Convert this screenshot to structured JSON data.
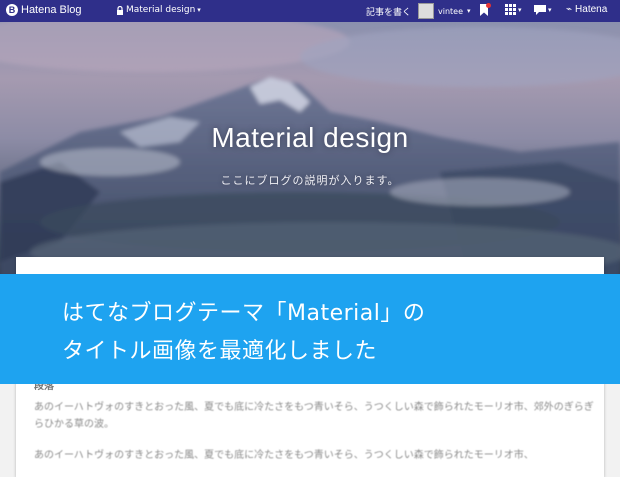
{
  "topbar": {
    "logo_text": "Hatena Blog",
    "blog_select": "Material design",
    "write_label": "記事を書く",
    "username": "vintee",
    "brand_text": "Hatena",
    "bg_color": "#2f2f8a"
  },
  "hero": {
    "title": "Material design",
    "description": "ここにブログの説明が入ります。"
  },
  "article": {
    "section_heading": "段落",
    "paragraph1": "あのイーハトヴォのすきとおった風、夏でも底に冷たさをもつ青いそら、うつくしい森で飾られたモーリオ市、郊外のぎらぎらひかる草の波。",
    "paragraph2": "あのイーハトヴォのすきとおった風、夏でも底に冷たさをもつ青いそら、うつくしい森で飾られたモーリオ市、"
  },
  "banner": {
    "line1": "はてなブログテーマ「Material」の",
    "line2": "タイトル画像を最適化しました",
    "bg_color": "#1ea3f0"
  },
  "icons": [
    "hatena-logo-icon",
    "lock-icon",
    "chevron-down-icon",
    "avatar",
    "bookmark-icon",
    "grid-icon",
    "chat-icon",
    "brand-mark-icon"
  ]
}
